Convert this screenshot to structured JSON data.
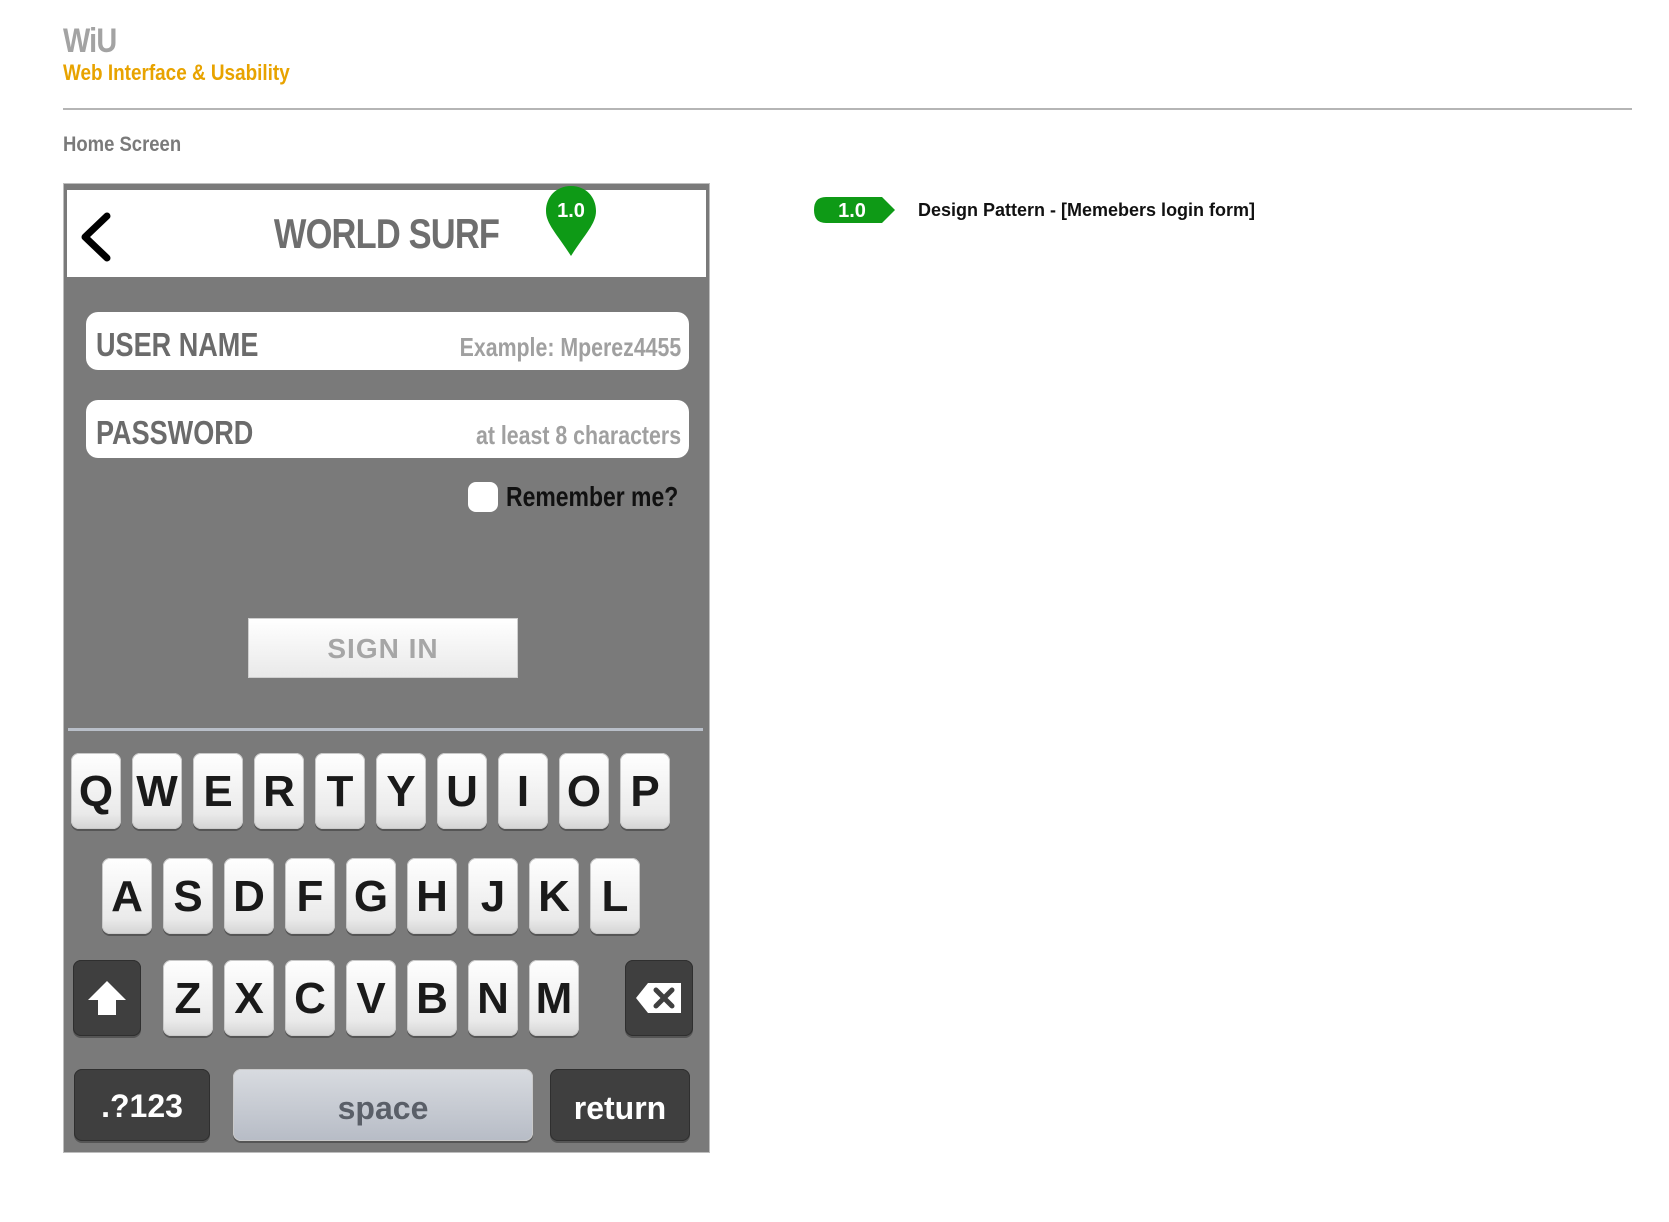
{
  "brand": {
    "title": "WiU",
    "subtitle": "Web Interface & Usability"
  },
  "page": {
    "screen_label": "Home Screen"
  },
  "app": {
    "title": "WORLD SURF",
    "pin_label": "1.0",
    "username": {
      "label": "USER NAME",
      "placeholder": "Example: Mperez4455"
    },
    "password": {
      "label": "PASSWORD",
      "placeholder": "at least 8 characters"
    },
    "remember_label": "Remember me?",
    "signin_label": "SIGN IN"
  },
  "keyboard": {
    "row1": [
      "Q",
      "W",
      "E",
      "R",
      "T",
      "Y",
      "U",
      "I",
      "O",
      "P"
    ],
    "row2": [
      "A",
      "S",
      "D",
      "F",
      "G",
      "H",
      "J",
      "K",
      "L"
    ],
    "row3": [
      "Z",
      "X",
      "C",
      "V",
      "B",
      "N",
      "M"
    ],
    "numbers_label": ".?123",
    "space_label": "space",
    "return_label": "return",
    "shift_icon": "shift-arrow-icon",
    "delete_icon": "backspace-icon"
  },
  "annotation": {
    "tag": "1.0",
    "text": "Design Pattern - [Memebers login form]"
  },
  "colors": {
    "accent_orange": "#e8a300",
    "tag_green": "#0e9a16",
    "phone_bg": "#7a7a7a",
    "title_gray": "#6e6e6e"
  }
}
